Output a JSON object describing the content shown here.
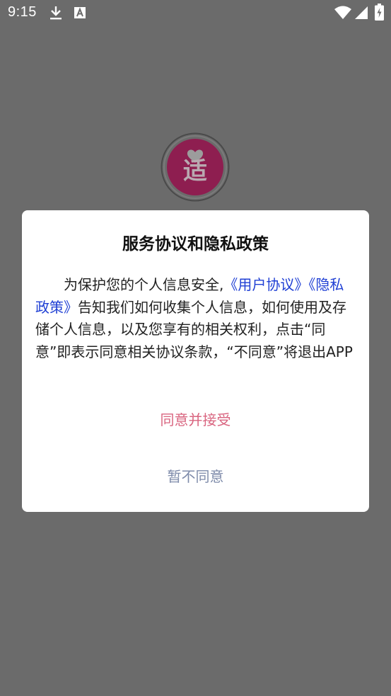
{
  "status_bar": {
    "time": "9:15",
    "icons": [
      "download-icon",
      "text-a-icon",
      "wifi-icon",
      "signal-icon",
      "battery-charging-icon"
    ]
  },
  "splash": {
    "logo_glyph": "适",
    "logo_icon": "heart-icon",
    "logo_color": "#8e1e50"
  },
  "dialog": {
    "title": "服务协议和隐私政策",
    "body": {
      "indent": "　　",
      "text1": "为保护您的个人信息安全,",
      "link_user_agreement": "《用户协议》",
      "link_privacy_policy": "《隐私政策》",
      "text2": "告知我们如何收集个人信息，如何使用及存储个人信息，以及您享有的相关权利，点击“同意”即表示同意相关协议条款，“不同意”将退出APP"
    },
    "accept_label": "同意并接受",
    "decline_label": "暂不同意"
  },
  "colors": {
    "overlay_background": "#6b6b6b",
    "link": "#1f3fd4",
    "accept": "#d9647f",
    "decline": "#7e8baa"
  }
}
